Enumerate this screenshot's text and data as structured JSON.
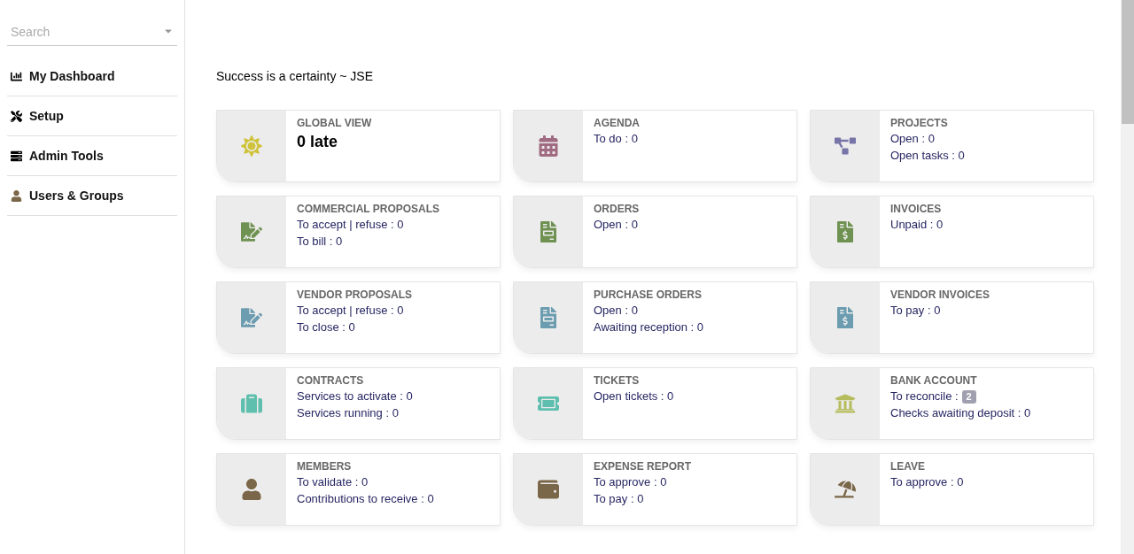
{
  "sidebar": {
    "search": {
      "placeholder": "Search"
    },
    "items": [
      {
        "label": "My Dashboard",
        "kind": "chart"
      },
      {
        "label": "Setup",
        "kind": "tools"
      },
      {
        "label": "Admin Tools",
        "kind": "server"
      },
      {
        "label": "Users & Groups",
        "kind": "user"
      }
    ]
  },
  "quote": "Success is a certainty ~ JSE",
  "cards": [
    {
      "title": "GLOBAL VIEW",
      "kind": "sun",
      "color": "#cfc33b",
      "headline": "0 late"
    },
    {
      "title": "AGENDA",
      "kind": "calendar",
      "color": "#a06b80",
      "lines": [
        {
          "text": "To do : 0"
        }
      ]
    },
    {
      "title": "PROJECTS",
      "kind": "diagram",
      "color": "#7775a8",
      "lines": [
        {
          "text": "Open : 0"
        },
        {
          "text": "Open tasks : 0"
        }
      ]
    },
    {
      "title": "COMMERCIAL PROPOSALS",
      "kind": "signature",
      "color": "#6f9151",
      "lines": [
        {
          "text": "To accept | refuse : 0"
        },
        {
          "text": "To bill : 0"
        }
      ]
    },
    {
      "title": "ORDERS",
      "kind": "invoice",
      "color": "#6f9151",
      "lines": [
        {
          "text": "Open : 0"
        }
      ]
    },
    {
      "title": "INVOICES",
      "kind": "dollar",
      "color": "#6f9151",
      "lines": [
        {
          "text": "Unpaid : 0"
        }
      ]
    },
    {
      "title": "VENDOR PROPOSALS",
      "kind": "signature",
      "color": "#6b9cb0",
      "lines": [
        {
          "text": "To accept | refuse : 0"
        },
        {
          "text": "To close : 0"
        }
      ]
    },
    {
      "title": "PURCHASE ORDERS",
      "kind": "invoice",
      "color": "#6b9cb0",
      "lines": [
        {
          "text": "Open : 0"
        },
        {
          "text": "Awaiting reception : 0"
        }
      ]
    },
    {
      "title": "VENDOR INVOICES",
      "kind": "dollar",
      "color": "#6b9cb0",
      "lines": [
        {
          "text": "To pay : 0"
        }
      ]
    },
    {
      "title": "CONTRACTS",
      "kind": "suitcase",
      "color": "#5fbfae",
      "lines": [
        {
          "text": "Services to activate : 0"
        },
        {
          "text": "Services running : 0"
        }
      ]
    },
    {
      "title": "TICKETS",
      "kind": "ticket",
      "color": "#5fbfae",
      "lines": [
        {
          "text": "Open tickets : 0"
        }
      ]
    },
    {
      "title": "BANK ACCOUNT",
      "kind": "bank",
      "color": "#b5bc5c",
      "lines": [
        {
          "text": "To reconcile :",
          "badge": "2"
        },
        {
          "text": "Checks awaiting deposit : 0"
        }
      ]
    },
    {
      "title": "MEMBERS",
      "kind": "user",
      "color": "#7a6648",
      "lines": [
        {
          "text": "To validate : 0"
        },
        {
          "text": "Contributions to receive : 0"
        }
      ]
    },
    {
      "title": "EXPENSE REPORT",
      "kind": "wallet",
      "color": "#7a6648",
      "lines": [
        {
          "text": "To approve : 0"
        },
        {
          "text": "To pay : 0"
        }
      ]
    },
    {
      "title": "LEAVE",
      "kind": "beach",
      "color": "#7a6648",
      "lines": [
        {
          "text": "To approve : 0"
        }
      ]
    }
  ]
}
